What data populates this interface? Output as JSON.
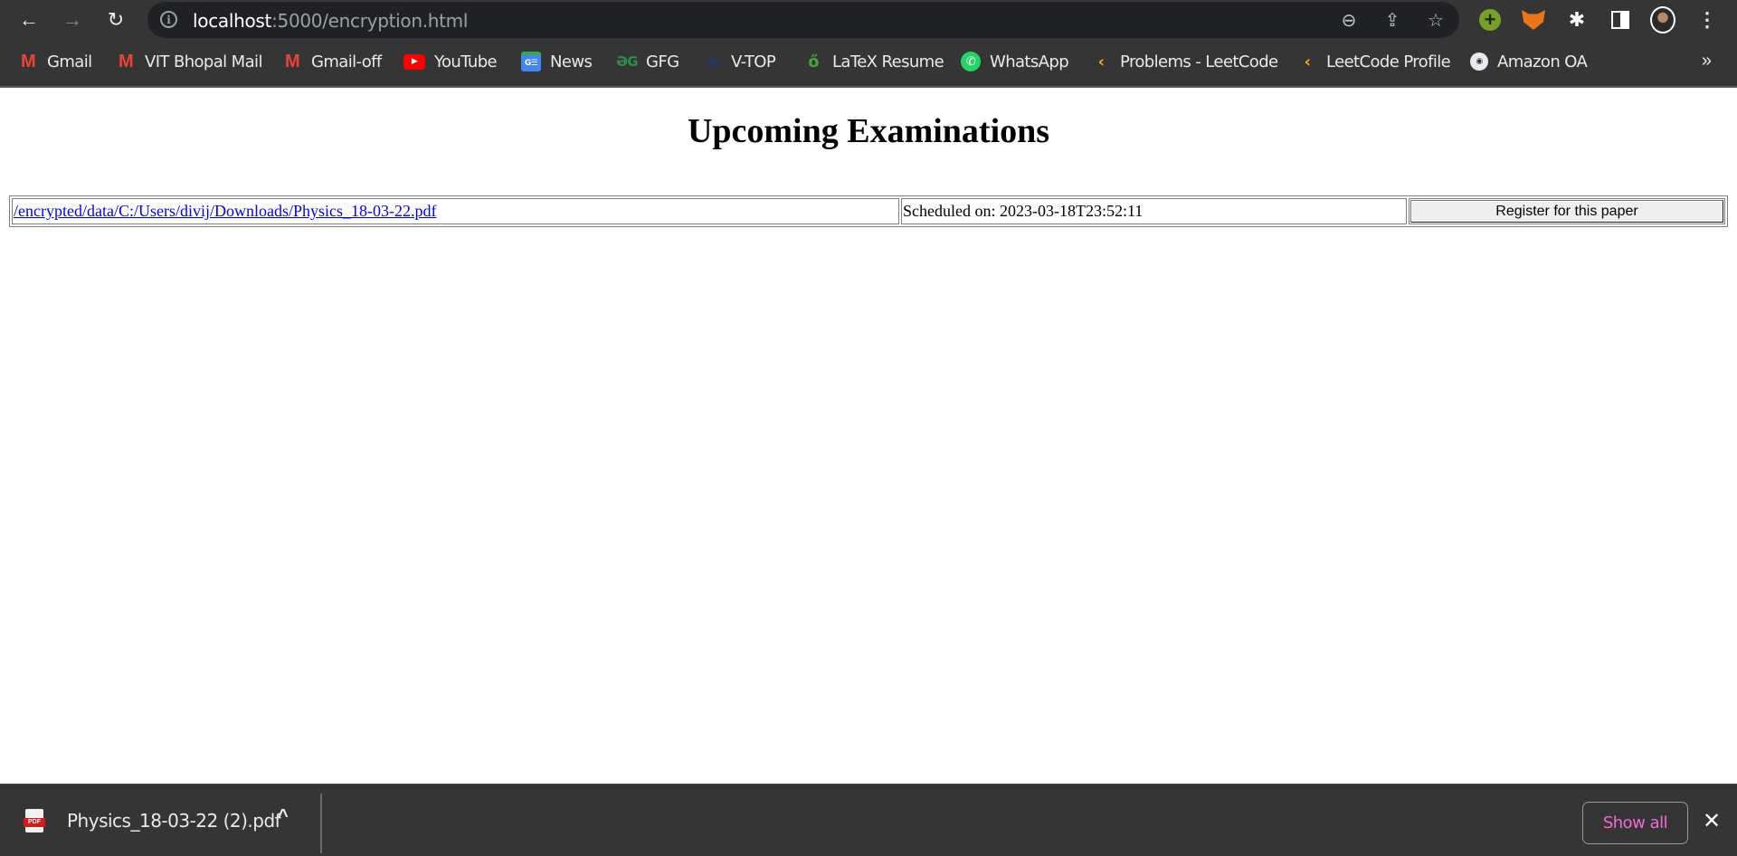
{
  "browser": {
    "url_host": "localhost",
    "url_rest": ":5000/encryption.html",
    "nav": {
      "back": "back-icon",
      "forward": "forward-icon",
      "reload": "reload-icon"
    },
    "bookmarks": [
      {
        "label": "Gmail",
        "icon": "gmail-icon"
      },
      {
        "label": "VIT Bhopal Mail",
        "icon": "gmail-icon"
      },
      {
        "label": "Gmail-off",
        "icon": "gmail-icon"
      },
      {
        "label": "YouTube",
        "icon": "youtube-icon"
      },
      {
        "label": "News",
        "icon": "google-news-icon"
      },
      {
        "label": "GFG",
        "icon": "gfg-icon"
      },
      {
        "label": "V-TOP",
        "icon": "vtop-icon"
      },
      {
        "label": "LaTeX Resume",
        "icon": "overleaf-icon"
      },
      {
        "label": "WhatsApp",
        "icon": "whatsapp-icon"
      },
      {
        "label": "Problems - LeetCode",
        "icon": "leetcode-icon"
      },
      {
        "label": "LeetCode Profile",
        "icon": "leetcode-icon"
      },
      {
        "label": "Amazon OA",
        "icon": "amazon-oa-icon"
      }
    ],
    "more_bookmarks": "»"
  },
  "page": {
    "title": "Upcoming Examinations",
    "exams": [
      {
        "link": "/encrypted/data/C:/Users/divij/Downloads/Physics_18-03-22.pdf",
        "scheduled": "Scheduled on: 2023-03-18T23:52:11",
        "button": "Register for this paper"
      }
    ]
  },
  "downloads": {
    "file_name": "Physics_18-03-22 (2).pdf",
    "file_icon_label": "PDF",
    "show_all": "Show all",
    "accent": "#f06ad8"
  }
}
